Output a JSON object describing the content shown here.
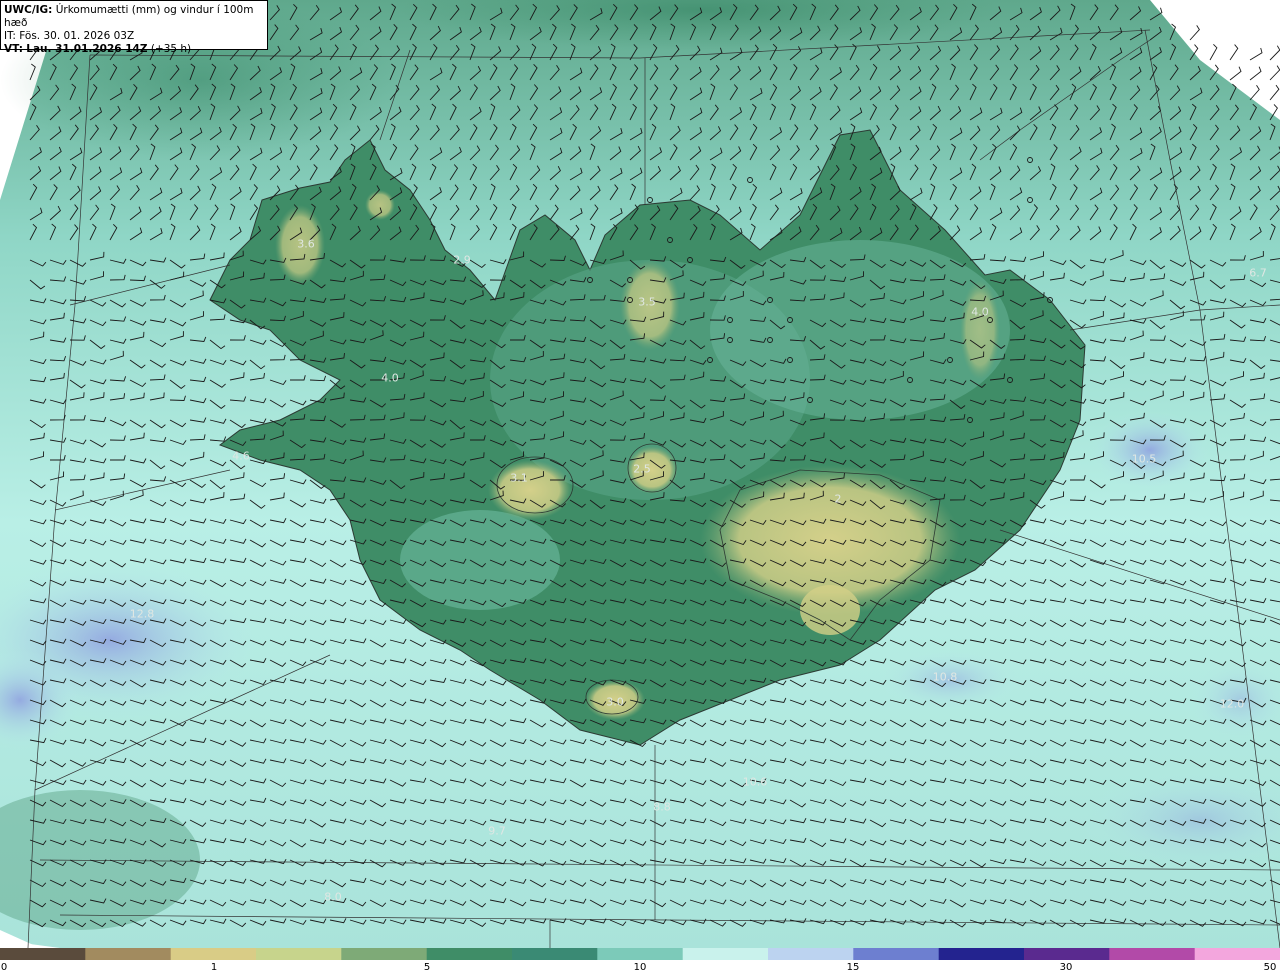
{
  "header": {
    "model": "UWC/IG:",
    "field": "Úrkomumætti (mm) og vindur í 100m hæð",
    "it_label": "IT:",
    "it_value": "Fös. 30. 01. 2026 03Z",
    "vt_label": "VT:",
    "vt_value": "Lau. 31.01.2026 14Z",
    "lead": "(+35 h)"
  },
  "map_labels": [
    "3.6",
    "2.9",
    "4.0",
    "4.6",
    "3.1",
    "3.5",
    "2.5",
    "4.0",
    "2",
    "6.7",
    "10.5",
    "12.8",
    "3.0",
    "10.8",
    "10.6",
    "12.0",
    "9.7",
    "8.0",
    "8.8"
  ],
  "colorbar": {
    "ticks": [
      "0",
      "1",
      "5",
      "10",
      "15",
      "30",
      "50"
    ],
    "colors": [
      "#5a4b3c",
      "#a28b5f",
      "#d9cc86",
      "#c7d48c",
      "#7eaa77",
      "#3f8d67",
      "#3a8a74",
      "#7ccab9",
      "#c9f2ec",
      "#bcd3f0",
      "#6d7fd0",
      "#23238f",
      "#5a2a8f",
      "#b24aa8",
      "#f3a6dd"
    ]
  },
  "icons": [
    "wind-barb-icon",
    "calm-circle-icon"
  ]
}
